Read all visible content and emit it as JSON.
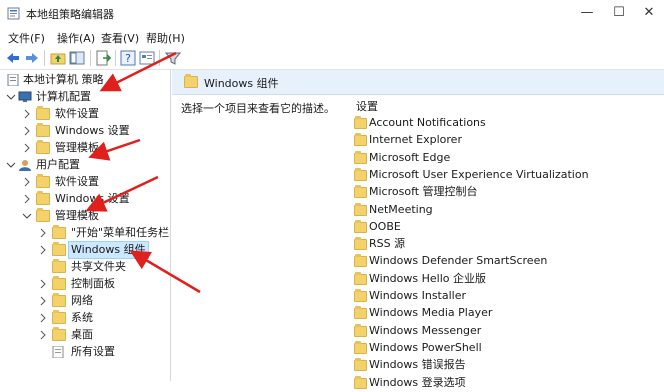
{
  "window": {
    "title": "本地组策略编辑器",
    "minimize": "—",
    "maximize": "☐",
    "close": "✕"
  },
  "menu": [
    "文件(F)",
    "操作(A)",
    "查看(V)",
    "帮助(H)"
  ],
  "tree": {
    "root": "本地计算机 策略",
    "computer_config": "计算机配置",
    "cc_software": "软件设置",
    "cc_windows": "Windows 设置",
    "cc_admin": "管理模板",
    "user_config": "用户配置",
    "uc_software": "软件设置",
    "uc_windows": "Windows 设置",
    "uc_admin": "管理模板",
    "uc_start": "\"开始\"菜单和任务栏",
    "uc_wincomp": "Windows 组件",
    "uc_shared": "共享文件夹",
    "uc_control": "控制面板",
    "uc_network": "网络",
    "uc_system": "系统",
    "uc_desktop": "桌面",
    "uc_all": "所有设置"
  },
  "right": {
    "header": "Windows 组件",
    "description": "选择一个项目来查看它的描述。",
    "column": "设置",
    "items": [
      "Account Notifications",
      "Internet Explorer",
      "Microsoft Edge",
      "Microsoft User Experience Virtualization",
      "Microsoft 管理控制台",
      "NetMeeting",
      "OOBE",
      "RSS 源",
      "Windows Defender SmartScreen",
      "Windows Hello 企业版",
      "Windows Installer",
      "Windows Media Player",
      "Windows Messenger",
      "Windows PowerShell",
      "Windows 错误报告",
      "Windows 登录选项"
    ]
  },
  "colors": {
    "annotation_arrow": "#e0201c",
    "selection": "#cce8ff",
    "header_bg": "#e7f1fb"
  }
}
